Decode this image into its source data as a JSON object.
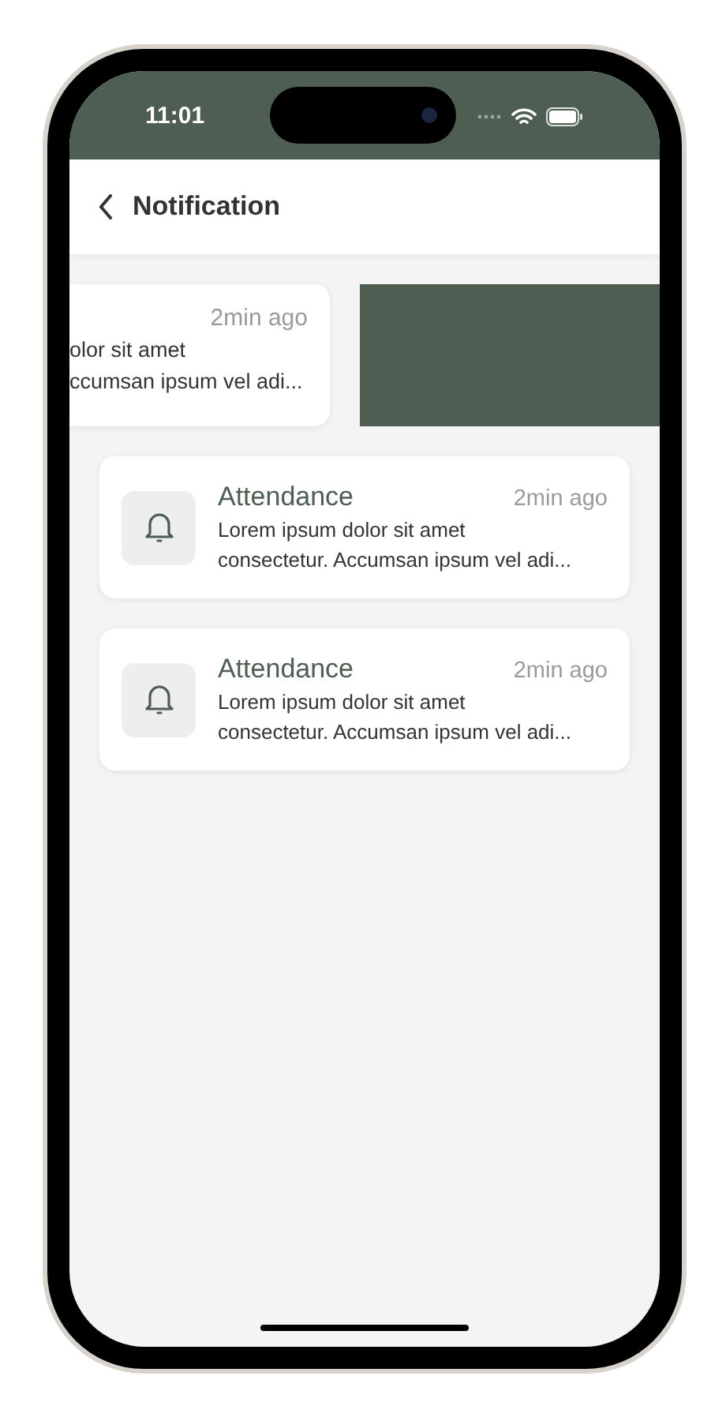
{
  "status_bar": {
    "time": "11:01"
  },
  "header": {
    "title": "Notification"
  },
  "notifications": [
    {
      "kind": "swiped",
      "time": "2min ago",
      "lines": [
        "olor sit amet",
        "ccumsan ipsum vel adi..."
      ]
    },
    {
      "kind": "normal",
      "title": "Attendance",
      "time": "2min ago",
      "lines": [
        "Lorem ipsum dolor sit amet",
        "consectetur. Accumsan ipsum vel adi..."
      ]
    },
    {
      "kind": "normal",
      "title": "Attendance",
      "time": "2min ago",
      "lines": [
        "Lorem ipsum dolor sit amet",
        "consectetur. Accumsan ipsum vel adi..."
      ]
    }
  ]
}
